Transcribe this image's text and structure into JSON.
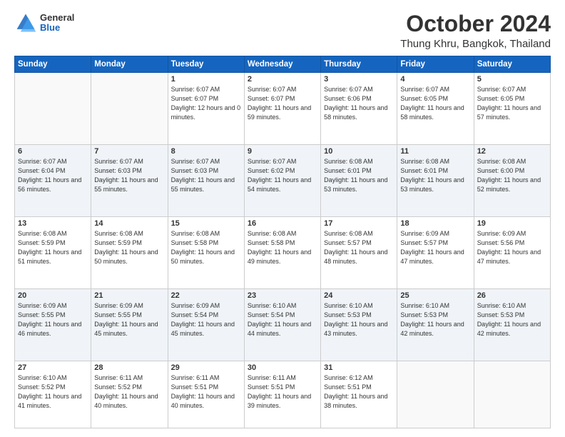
{
  "logo": {
    "general": "General",
    "blue": "Blue"
  },
  "title": "October 2024",
  "location": "Thung Khru, Bangkok, Thailand",
  "days_of_week": [
    "Sunday",
    "Monday",
    "Tuesday",
    "Wednesday",
    "Thursday",
    "Friday",
    "Saturday"
  ],
  "weeks": [
    [
      {
        "day": "",
        "info": ""
      },
      {
        "day": "",
        "info": ""
      },
      {
        "day": "1",
        "sunrise": "Sunrise: 6:07 AM",
        "sunset": "Sunset: 6:07 PM",
        "daylight": "Daylight: 12 hours and 0 minutes."
      },
      {
        "day": "2",
        "sunrise": "Sunrise: 6:07 AM",
        "sunset": "Sunset: 6:07 PM",
        "daylight": "Daylight: 11 hours and 59 minutes."
      },
      {
        "day": "3",
        "sunrise": "Sunrise: 6:07 AM",
        "sunset": "Sunset: 6:06 PM",
        "daylight": "Daylight: 11 hours and 58 minutes."
      },
      {
        "day": "4",
        "sunrise": "Sunrise: 6:07 AM",
        "sunset": "Sunset: 6:05 PM",
        "daylight": "Daylight: 11 hours and 58 minutes."
      },
      {
        "day": "5",
        "sunrise": "Sunrise: 6:07 AM",
        "sunset": "Sunset: 6:05 PM",
        "daylight": "Daylight: 11 hours and 57 minutes."
      }
    ],
    [
      {
        "day": "6",
        "sunrise": "Sunrise: 6:07 AM",
        "sunset": "Sunset: 6:04 PM",
        "daylight": "Daylight: 11 hours and 56 minutes."
      },
      {
        "day": "7",
        "sunrise": "Sunrise: 6:07 AM",
        "sunset": "Sunset: 6:03 PM",
        "daylight": "Daylight: 11 hours and 55 minutes."
      },
      {
        "day": "8",
        "sunrise": "Sunrise: 6:07 AM",
        "sunset": "Sunset: 6:03 PM",
        "daylight": "Daylight: 11 hours and 55 minutes."
      },
      {
        "day": "9",
        "sunrise": "Sunrise: 6:07 AM",
        "sunset": "Sunset: 6:02 PM",
        "daylight": "Daylight: 11 hours and 54 minutes."
      },
      {
        "day": "10",
        "sunrise": "Sunrise: 6:08 AM",
        "sunset": "Sunset: 6:01 PM",
        "daylight": "Daylight: 11 hours and 53 minutes."
      },
      {
        "day": "11",
        "sunrise": "Sunrise: 6:08 AM",
        "sunset": "Sunset: 6:01 PM",
        "daylight": "Daylight: 11 hours and 53 minutes."
      },
      {
        "day": "12",
        "sunrise": "Sunrise: 6:08 AM",
        "sunset": "Sunset: 6:00 PM",
        "daylight": "Daylight: 11 hours and 52 minutes."
      }
    ],
    [
      {
        "day": "13",
        "sunrise": "Sunrise: 6:08 AM",
        "sunset": "Sunset: 5:59 PM",
        "daylight": "Daylight: 11 hours and 51 minutes."
      },
      {
        "day": "14",
        "sunrise": "Sunrise: 6:08 AM",
        "sunset": "Sunset: 5:59 PM",
        "daylight": "Daylight: 11 hours and 50 minutes."
      },
      {
        "day": "15",
        "sunrise": "Sunrise: 6:08 AM",
        "sunset": "Sunset: 5:58 PM",
        "daylight": "Daylight: 11 hours and 50 minutes."
      },
      {
        "day": "16",
        "sunrise": "Sunrise: 6:08 AM",
        "sunset": "Sunset: 5:58 PM",
        "daylight": "Daylight: 11 hours and 49 minutes."
      },
      {
        "day": "17",
        "sunrise": "Sunrise: 6:08 AM",
        "sunset": "Sunset: 5:57 PM",
        "daylight": "Daylight: 11 hours and 48 minutes."
      },
      {
        "day": "18",
        "sunrise": "Sunrise: 6:09 AM",
        "sunset": "Sunset: 5:57 PM",
        "daylight": "Daylight: 11 hours and 47 minutes."
      },
      {
        "day": "19",
        "sunrise": "Sunrise: 6:09 AM",
        "sunset": "Sunset: 5:56 PM",
        "daylight": "Daylight: 11 hours and 47 minutes."
      }
    ],
    [
      {
        "day": "20",
        "sunrise": "Sunrise: 6:09 AM",
        "sunset": "Sunset: 5:55 PM",
        "daylight": "Daylight: 11 hours and 46 minutes."
      },
      {
        "day": "21",
        "sunrise": "Sunrise: 6:09 AM",
        "sunset": "Sunset: 5:55 PM",
        "daylight": "Daylight: 11 hours and 45 minutes."
      },
      {
        "day": "22",
        "sunrise": "Sunrise: 6:09 AM",
        "sunset": "Sunset: 5:54 PM",
        "daylight": "Daylight: 11 hours and 45 minutes."
      },
      {
        "day": "23",
        "sunrise": "Sunrise: 6:10 AM",
        "sunset": "Sunset: 5:54 PM",
        "daylight": "Daylight: 11 hours and 44 minutes."
      },
      {
        "day": "24",
        "sunrise": "Sunrise: 6:10 AM",
        "sunset": "Sunset: 5:53 PM",
        "daylight": "Daylight: 11 hours and 43 minutes."
      },
      {
        "day": "25",
        "sunrise": "Sunrise: 6:10 AM",
        "sunset": "Sunset: 5:53 PM",
        "daylight": "Daylight: 11 hours and 42 minutes."
      },
      {
        "day": "26",
        "sunrise": "Sunrise: 6:10 AM",
        "sunset": "Sunset: 5:53 PM",
        "daylight": "Daylight: 11 hours and 42 minutes."
      }
    ],
    [
      {
        "day": "27",
        "sunrise": "Sunrise: 6:10 AM",
        "sunset": "Sunset: 5:52 PM",
        "daylight": "Daylight: 11 hours and 41 minutes."
      },
      {
        "day": "28",
        "sunrise": "Sunrise: 6:11 AM",
        "sunset": "Sunset: 5:52 PM",
        "daylight": "Daylight: 11 hours and 40 minutes."
      },
      {
        "day": "29",
        "sunrise": "Sunrise: 6:11 AM",
        "sunset": "Sunset: 5:51 PM",
        "daylight": "Daylight: 11 hours and 40 minutes."
      },
      {
        "day": "30",
        "sunrise": "Sunrise: 6:11 AM",
        "sunset": "Sunset: 5:51 PM",
        "daylight": "Daylight: 11 hours and 39 minutes."
      },
      {
        "day": "31",
        "sunrise": "Sunrise: 6:12 AM",
        "sunset": "Sunset: 5:51 PM",
        "daylight": "Daylight: 11 hours and 38 minutes."
      },
      {
        "day": "",
        "info": ""
      },
      {
        "day": "",
        "info": ""
      }
    ]
  ]
}
